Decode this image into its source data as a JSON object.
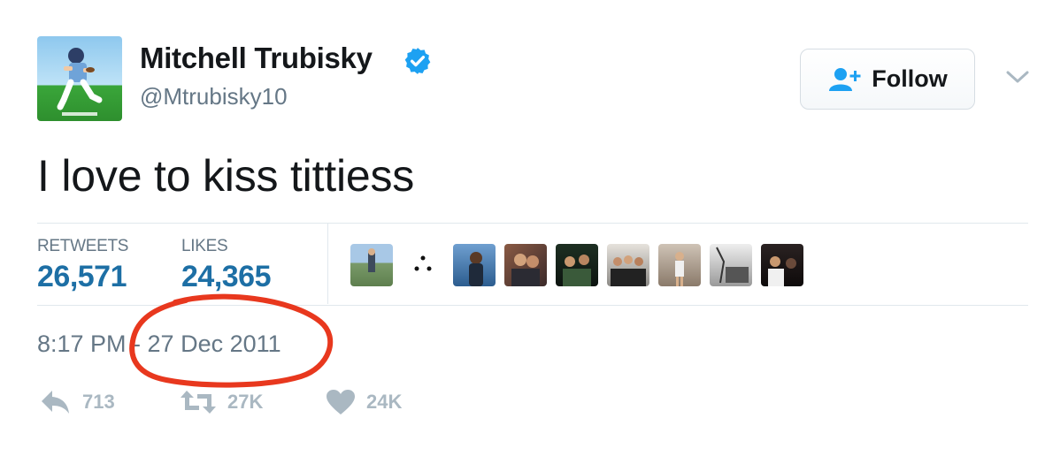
{
  "tweet": {
    "author_name": "Mitchell Trubisky",
    "handle": "@Mtrubisky10",
    "text": "I love to kiss tittiess",
    "follow_label": "Follow",
    "stats": {
      "retweets_label": "RETWEETS",
      "retweets_value": "26,571",
      "likes_label": "LIKES",
      "likes_value": "24,365"
    },
    "timestamp": "8:17 PM - 27 Dec 2011",
    "actions": {
      "reply_count": "713",
      "retweet_count": "27K",
      "like_count": "24K"
    },
    "liker_avatar_count": 9
  },
  "colors": {
    "verified_badge": "#1da1f2",
    "stat_value": "#1d6fa5",
    "muted_text": "#657786",
    "action_icon": "#aab8c2",
    "annotation_circle": "#e8381e"
  },
  "icons": {
    "verified": "verified-badge-icon",
    "follow": "person-plus-icon",
    "menu": "chevron-down-icon",
    "reply": "reply-icon",
    "retweet": "retweet-icon",
    "like": "heart-icon"
  }
}
